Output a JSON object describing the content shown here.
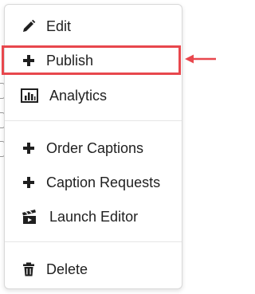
{
  "menu": {
    "items": [
      {
        "label": "Edit",
        "icon": "pencil-icon"
      },
      {
        "label": "Publish",
        "icon": "plus-icon"
      },
      {
        "label": "Analytics",
        "icon": "bar-chart-icon"
      },
      {
        "label": "Order Captions",
        "icon": "plus-icon"
      },
      {
        "label": "Caption Requests",
        "icon": "plus-icon"
      },
      {
        "label": "Launch Editor",
        "icon": "film-clapper-icon"
      },
      {
        "label": "Delete",
        "icon": "trash-icon"
      }
    ]
  },
  "annotation": {
    "highlighted_item": "Publish",
    "color": "#e8474d"
  }
}
